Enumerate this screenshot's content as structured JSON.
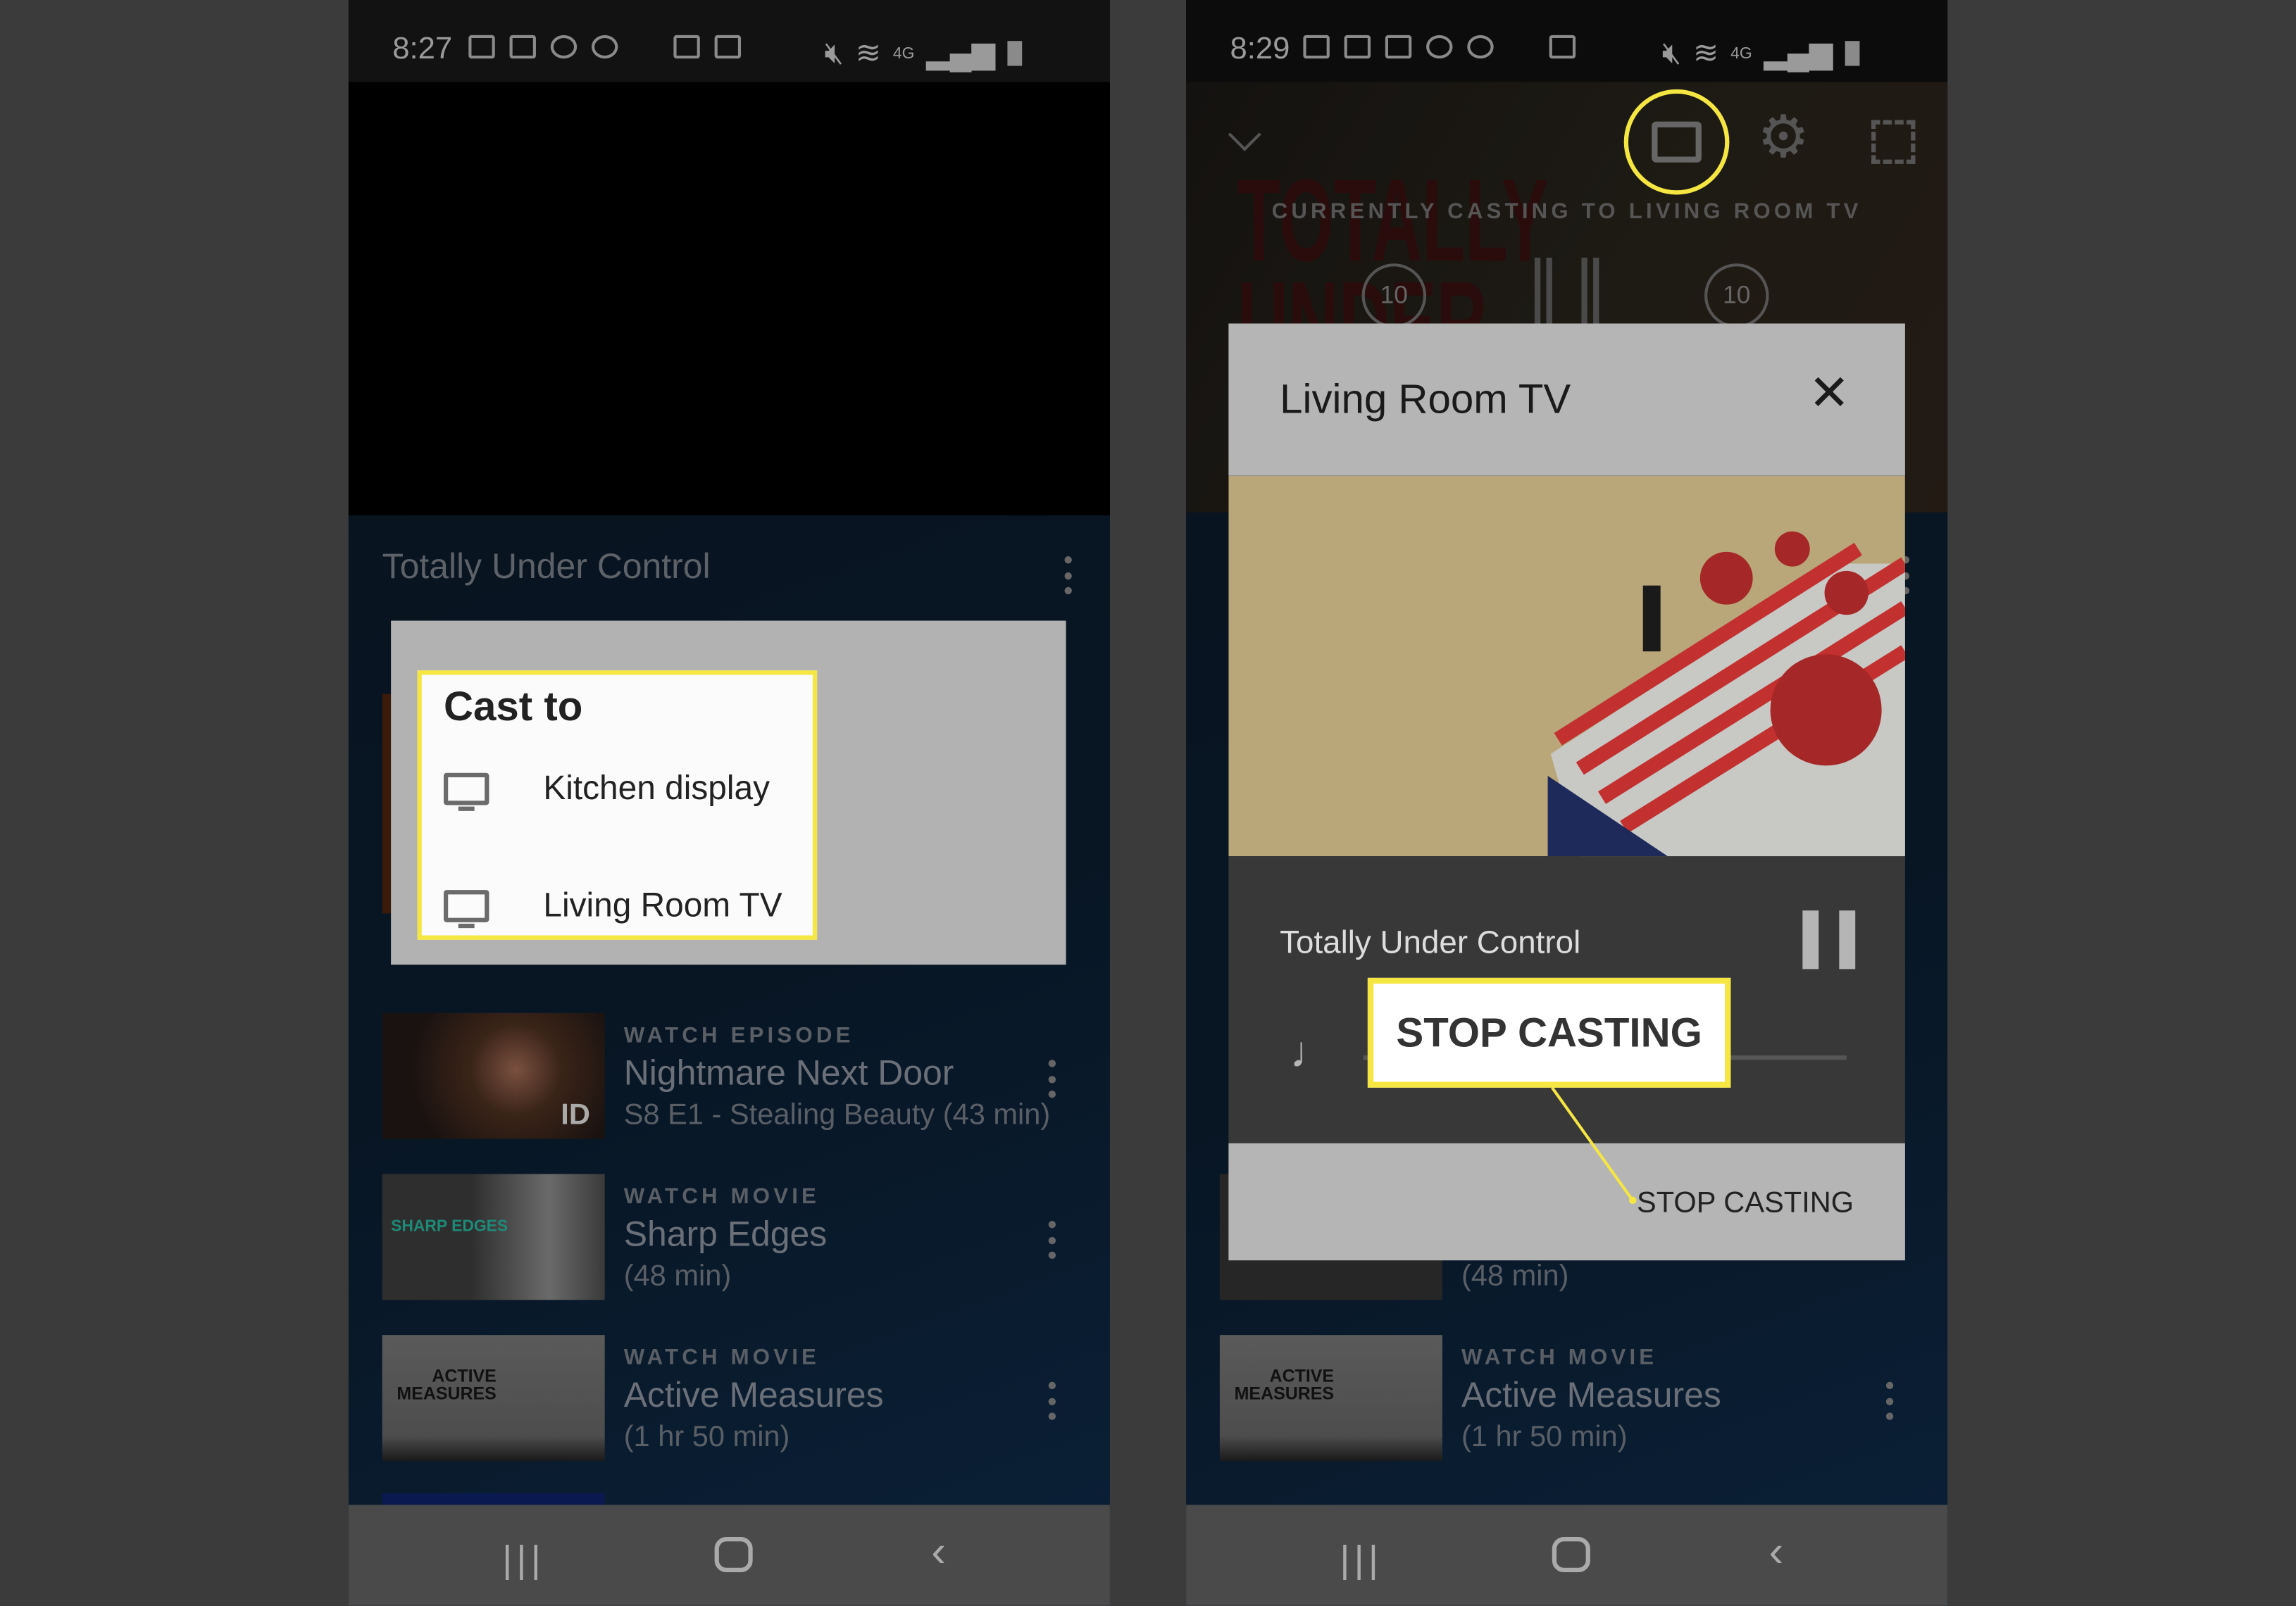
{
  "left_phone": {
    "status_bar": {
      "time": "8:27",
      "network": "4G"
    },
    "show_title": "Totally Under Control",
    "cast_dialog": {
      "title": "Cast to",
      "devices": [
        {
          "icon": "tv-icon",
          "label": "Kitchen display"
        },
        {
          "icon": "tv-icon",
          "label": "Living Room TV"
        }
      ]
    },
    "list": [
      {
        "label": "WATCH EPISODE",
        "title": "Nightmare Next Door",
        "subtitle": "S8 E1 - Stealing Beauty (43 min)",
        "thumb_text": "ID"
      },
      {
        "label": "WATCH MOVIE",
        "title": "Sharp Edges",
        "subtitle": "(48 min)",
        "thumb_text": "SHARP EDGES"
      },
      {
        "label": "WATCH MOVIE",
        "title": "Active Measures",
        "subtitle": "(1 hr 50 min)",
        "thumb_text": "ACTIVE MEASURES"
      }
    ]
  },
  "right_phone": {
    "status_bar": {
      "time": "8:29",
      "network": "4G"
    },
    "player": {
      "casting_text": "CURRENTLY CASTING TO LIVING ROOM TV",
      "rewind_seconds": "10",
      "forward_seconds": "10",
      "poster_text": "TOTALLY UNDER"
    },
    "cast_dialog": {
      "title": "Living Room TV",
      "now_playing": "Totally Under Control",
      "stop_button": "STOP CASTING",
      "callout": "STOP CASTING"
    },
    "list": [
      {
        "subtitle": "(48 min)"
      },
      {
        "label": "WATCH MOVIE",
        "title": "Active Measures",
        "subtitle": "(1 hr 50 min)",
        "thumb_text": "ACTIVE MEASURES"
      }
    ]
  },
  "colors": {
    "highlight": "#f5e642",
    "dialog_gray": "#b3b3b3",
    "background": "#3b3b3b"
  }
}
